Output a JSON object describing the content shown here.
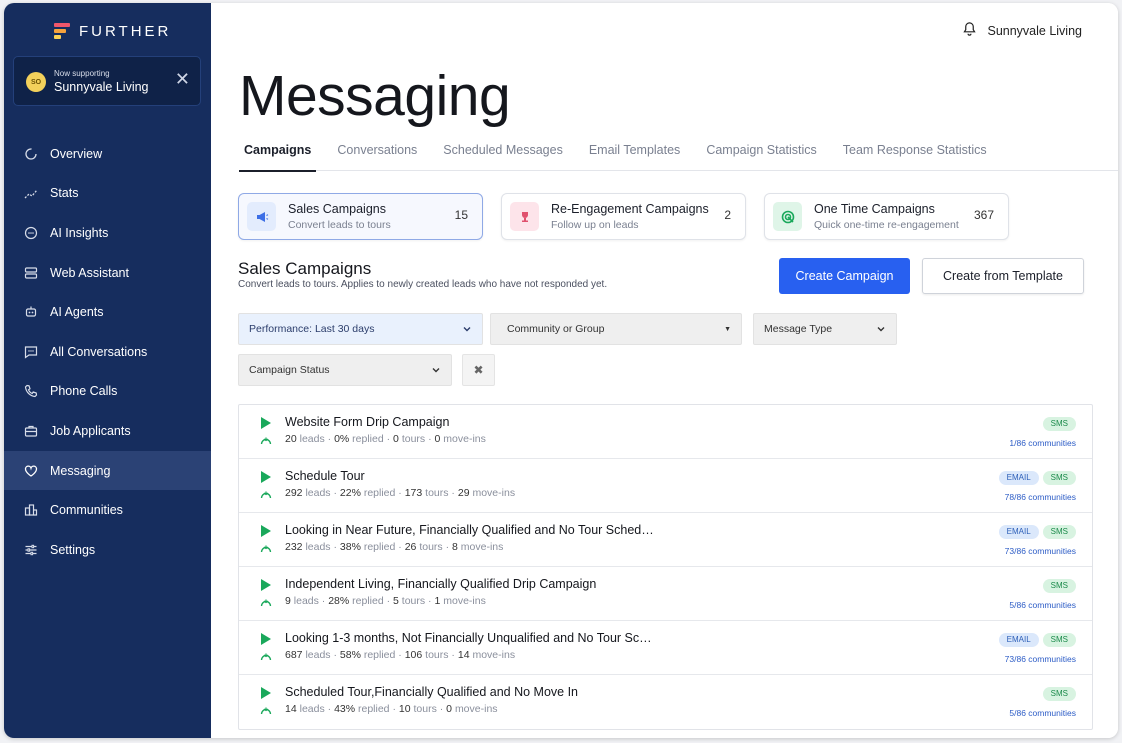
{
  "brand": {
    "name": "FURTHER",
    "colors": {
      "sidebar": "#162d5e",
      "accent": "#2860f0",
      "sms": "#1aa85b"
    }
  },
  "support": {
    "caption": "Now supporting",
    "community": "Sunnyvale Living",
    "avatar": "SO",
    "close_icon": "close-icon"
  },
  "nav": {
    "items": [
      {
        "label": "Overview",
        "icon": "overview-icon"
      },
      {
        "label": "Stats",
        "icon": "stats-icon"
      },
      {
        "label": "AI Insights",
        "icon": "insights-icon"
      },
      {
        "label": "Web Assistant",
        "icon": "web-assistant-icon"
      },
      {
        "label": "AI Agents",
        "icon": "robot-icon"
      },
      {
        "label": "All Conversations",
        "icon": "chat-icon"
      },
      {
        "label": "Phone Calls",
        "icon": "phone-icon"
      },
      {
        "label": "Job Applicants",
        "icon": "briefcase-icon"
      },
      {
        "label": "Messaging",
        "icon": "heart-icon"
      },
      {
        "label": "Communities",
        "icon": "building-icon"
      },
      {
        "label": "Settings",
        "icon": "sliders-icon"
      }
    ],
    "active": "Messaging"
  },
  "topbar": {
    "community": "Sunnyvale Living",
    "bell_icon": "bell-icon"
  },
  "page": {
    "title": "Messaging"
  },
  "tabs": [
    "Campaigns",
    "Conversations",
    "Scheduled Messages",
    "Email Templates",
    "Campaign Statistics",
    "Team Response Statistics"
  ],
  "active_tab": "Campaigns",
  "cards": [
    {
      "title": "Sales Campaigns",
      "subtitle": "Convert leads to tours",
      "count": "15",
      "icon": "megaphone-icon"
    },
    {
      "title": "Re-Engagement Campaigns",
      "subtitle": "Follow up on leads",
      "count": "2",
      "icon": "trophy-icon"
    },
    {
      "title": "One Time Campaigns",
      "subtitle": "Quick one-time re-engagement",
      "count": "367",
      "icon": "target-icon"
    }
  ],
  "section": {
    "title": "Sales Campaigns",
    "subtitle": "Convert leads to tours. Applies to newly created leads who have not responded yet.",
    "create_label": "Create Campaign",
    "template_label": "Create from Template"
  },
  "filters": {
    "performance": "Performance: Last 30 days",
    "community": "Community or Group",
    "message_type": "Message Type",
    "status": "Campaign Status",
    "clear_icon": "clear-filters-icon"
  },
  "campaigns": [
    {
      "name": "Website Form Drip Campaign",
      "leads": "20",
      "replied": "0%",
      "tours": "0",
      "moveins": "0",
      "email": false,
      "sms": true,
      "communities": "1/86 communities"
    },
    {
      "name": "Schedule Tour",
      "leads": "292",
      "replied": "22%",
      "tours": "173",
      "moveins": "29",
      "email": true,
      "sms": true,
      "communities": "78/86 communities"
    },
    {
      "name": "Looking in Near Future, Financially Qualified and No Tour Sched…",
      "leads": "232",
      "replied": "38%",
      "tours": "26",
      "moveins": "8",
      "email": true,
      "sms": true,
      "communities": "73/86 communities"
    },
    {
      "name": "Independent Living, Financially Qualified Drip Campaign",
      "leads": "9",
      "replied": "28%",
      "tours": "5",
      "moveins": "1",
      "email": false,
      "sms": true,
      "communities": "5/86 communities"
    },
    {
      "name": "Looking 1-3 months, Not Financially Unqualified and No Tour Sc…",
      "leads": "687",
      "replied": "58%",
      "tours": "106",
      "moveins": "14",
      "email": true,
      "sms": true,
      "communities": "73/86 communities"
    },
    {
      "name": "Scheduled Tour,Financially Qualified and No Move In",
      "leads": "14",
      "replied": "43%",
      "tours": "10",
      "moveins": "0",
      "email": false,
      "sms": true,
      "communities": "5/86 communities"
    }
  ],
  "labels": {
    "leads": "leads",
    "replied": "replied",
    "tours": "tours",
    "moveins": "move-ins",
    "sep": " · ",
    "email": "EMAIL",
    "sms": "SMS"
  }
}
